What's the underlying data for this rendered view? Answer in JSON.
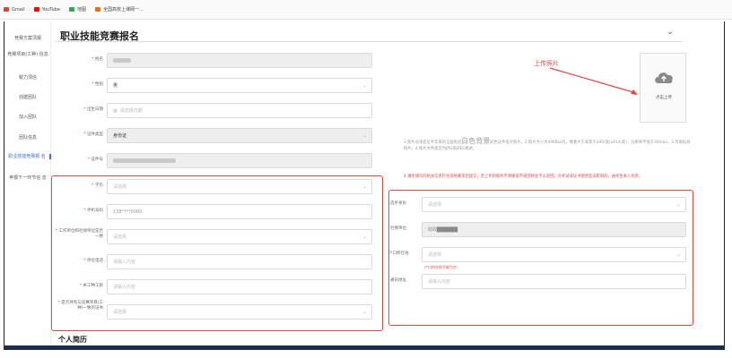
{
  "bookmarks": [
    {
      "label": "Gmail",
      "color": "#db4437"
    },
    {
      "label": "YouTube",
      "color": "#ff0000"
    },
    {
      "label": "地图",
      "color": "#34a853"
    },
    {
      "label": "全国高校上课网一...",
      "color": "#e8710a"
    }
  ],
  "sidebar": {
    "items": [
      {
        "label": "竞赛方案须报"
      },
      {
        "label": "竞赛项目(工种) 信息"
      },
      {
        "label": "税力须信"
      },
      {
        "label": "创建团队"
      },
      {
        "label": "加入团队"
      },
      {
        "label": "团队信息"
      },
      {
        "label": "职业技能竞赛报 名"
      },
      {
        "label": "申报下一环节信 息"
      }
    ]
  },
  "page": {
    "title": "职业技能竞赛报名",
    "collapse_icon": "chevron-down-icon"
  },
  "form": {
    "name": {
      "label": "姓名"
    },
    "gender": {
      "label": "性别",
      "value": "男"
    },
    "birth": {
      "label": "出生日期",
      "placeholder": "请选择日期"
    },
    "id_type": {
      "label": "证件类型",
      "value": "身份证"
    },
    "id_no": {
      "label": "证件号"
    },
    "education": {
      "label": "学历",
      "placeholder": "请选择"
    },
    "phone": {
      "label": "手机号码",
      "value": "138****0000"
    },
    "work_unit_cert": {
      "label": "工作单位和社保单位是否一致",
      "placeholder": "请选择"
    },
    "unit_phone": {
      "label": "单位电话",
      "placeholder": "请输入内容"
    },
    "work_years": {
      "label": "本工种工龄",
      "placeholder": "请输入内容"
    },
    "cert_match": {
      "label": "是否持有与竞赛项目(工种)一致的证书",
      "placeholder": "请选择"
    }
  },
  "right_form": {
    "identity": {
      "label": "选手身份",
      "placeholder": "请选择"
    },
    "social_unit": {
      "label": "社保单位",
      "value": "财政██████"
    },
    "hukou": {
      "label": "户口所在地",
      "placeholder": "请选择",
      "error": "户口所在地不能为空"
    },
    "address": {
      "label": "通讯地址",
      "placeholder": "请输入内容"
    }
  },
  "upload": {
    "annotation": "上传照片",
    "button": "点击上传",
    "icon": "cloud-upload-icon"
  },
  "hint": {
    "pre": "1.照片必须是近半年来的正面免冠",
    "big": "白色背景",
    "post": "彩色证件电子照片。2.照片大小为40KB以内，像素大于或等于295(宽)x413(高)，分辨率不低于300dpi。3.仅限标准照片。4.照片文件类型为JPG或JPEG格式。"
  },
  "warning": "4.请所填写的相关信息符合资格要求后提交，若上传的照片不清晰或不规范将会予以退回，对考试或证书使用造成影响的，由考生本人负责。",
  "section": {
    "title": "个人简历"
  },
  "colors": {
    "accent": "#3b6fd6",
    "annotation": "#e04848",
    "bottom_bar": "#1f2d4d"
  }
}
